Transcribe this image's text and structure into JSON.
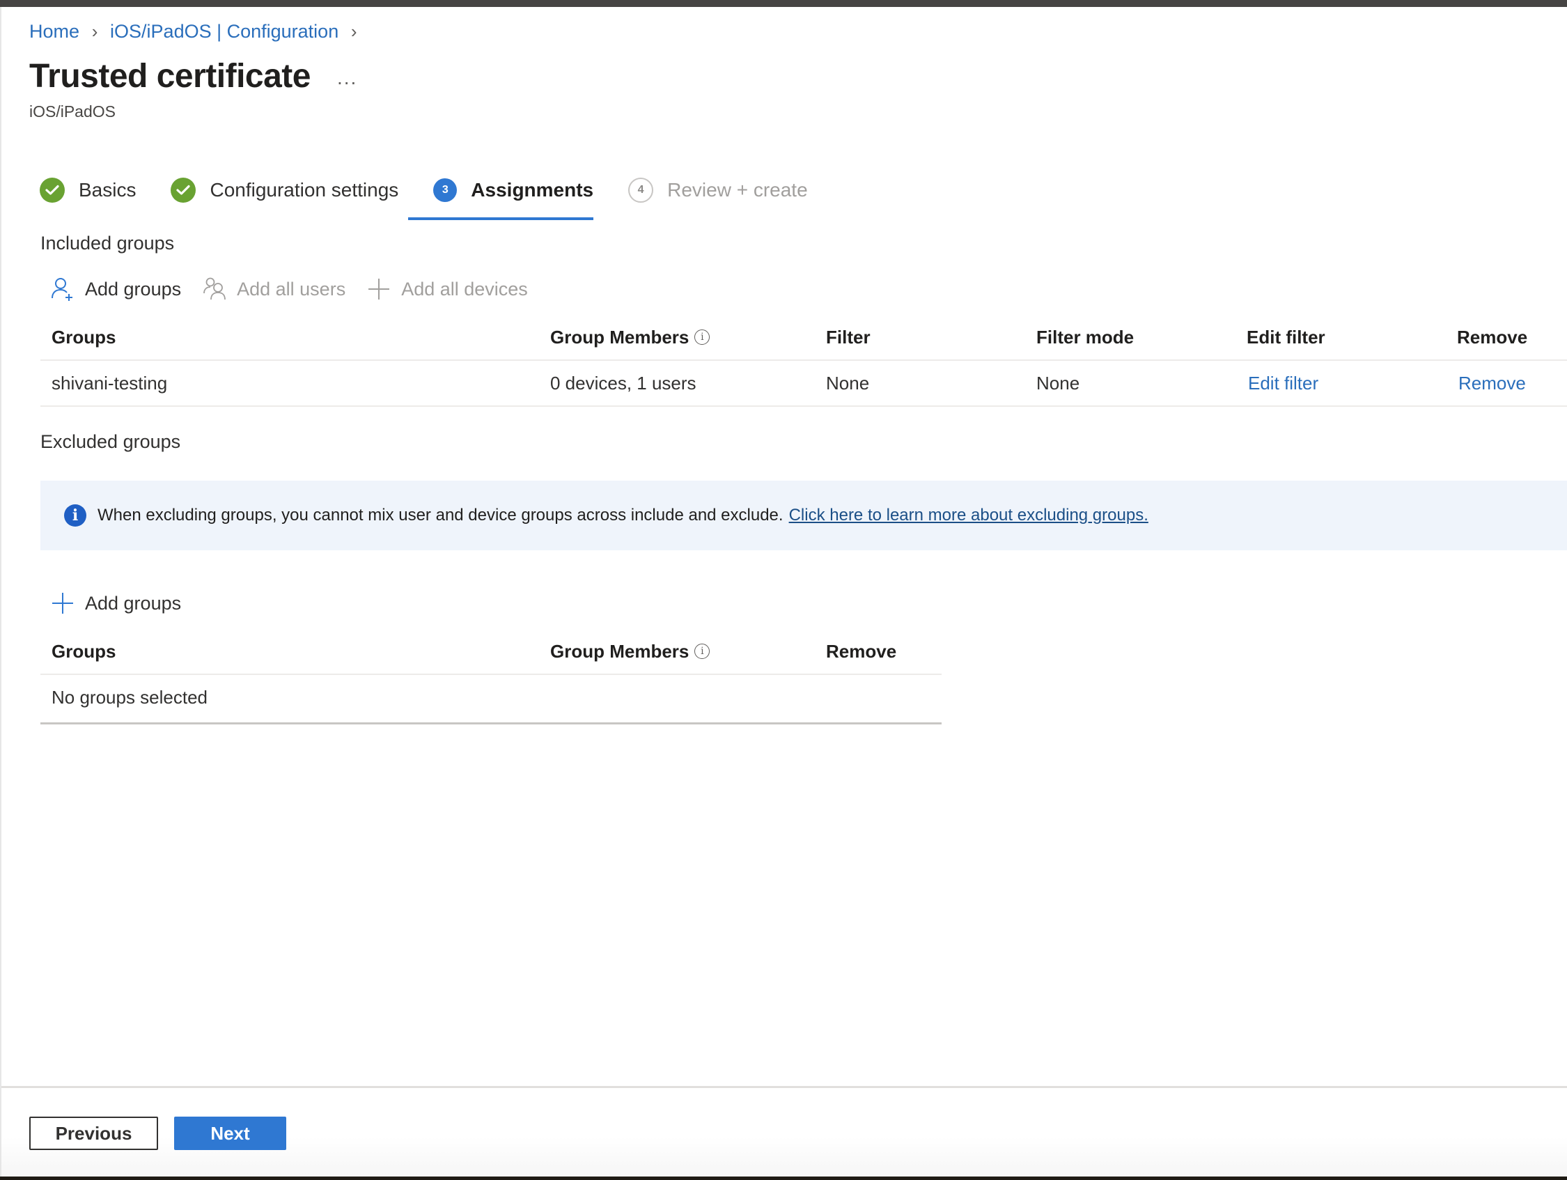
{
  "breadcrumb": {
    "items": [
      {
        "label": "Home"
      },
      {
        "label": "iOS/iPadOS | Configuration"
      }
    ],
    "separator": ">"
  },
  "header": {
    "title": "Trusted certificate",
    "more_label": "...",
    "subtitle": "iOS/iPadOS"
  },
  "stepper": {
    "steps": [
      {
        "label": "Basics",
        "state": "done",
        "icon": "checkmark-icon"
      },
      {
        "label": "Configuration settings",
        "state": "done",
        "icon": "checkmark-icon"
      },
      {
        "label": "Assignments",
        "state": "current",
        "number": "3"
      },
      {
        "label": "Review + create",
        "state": "future",
        "number": "4"
      }
    ]
  },
  "included": {
    "title": "Included groups",
    "toolbar": {
      "add_groups": "Add groups",
      "add_all_users": "Add all users",
      "add_all_devices": "Add all devices"
    },
    "columns": [
      "Groups",
      "Group Members",
      "Filter",
      "Filter mode",
      "Edit filter",
      "Remove"
    ],
    "rows": [
      {
        "group": "shivani-testing",
        "members": "0 devices, 1 users",
        "filter": "None",
        "filter_mode": "None",
        "edit_filter": "Edit filter",
        "remove": "Remove"
      }
    ]
  },
  "excluded": {
    "title": "Excluded groups",
    "banner": {
      "icon": "info-icon",
      "text": "When excluding groups, you cannot mix user and device groups across include and exclude.",
      "link": "Click here to learn more about excluding groups."
    },
    "add_groups": "Add groups",
    "columns": [
      "Groups",
      "Group Members",
      "Remove"
    ],
    "empty_text": "No groups selected"
  },
  "footer": {
    "previous": "Previous",
    "next": "Next"
  },
  "colors": {
    "accent": "#2f78d2",
    "link": "#2a6ebb",
    "success": "#69a232",
    "banner_bg": "#eff4fb"
  }
}
